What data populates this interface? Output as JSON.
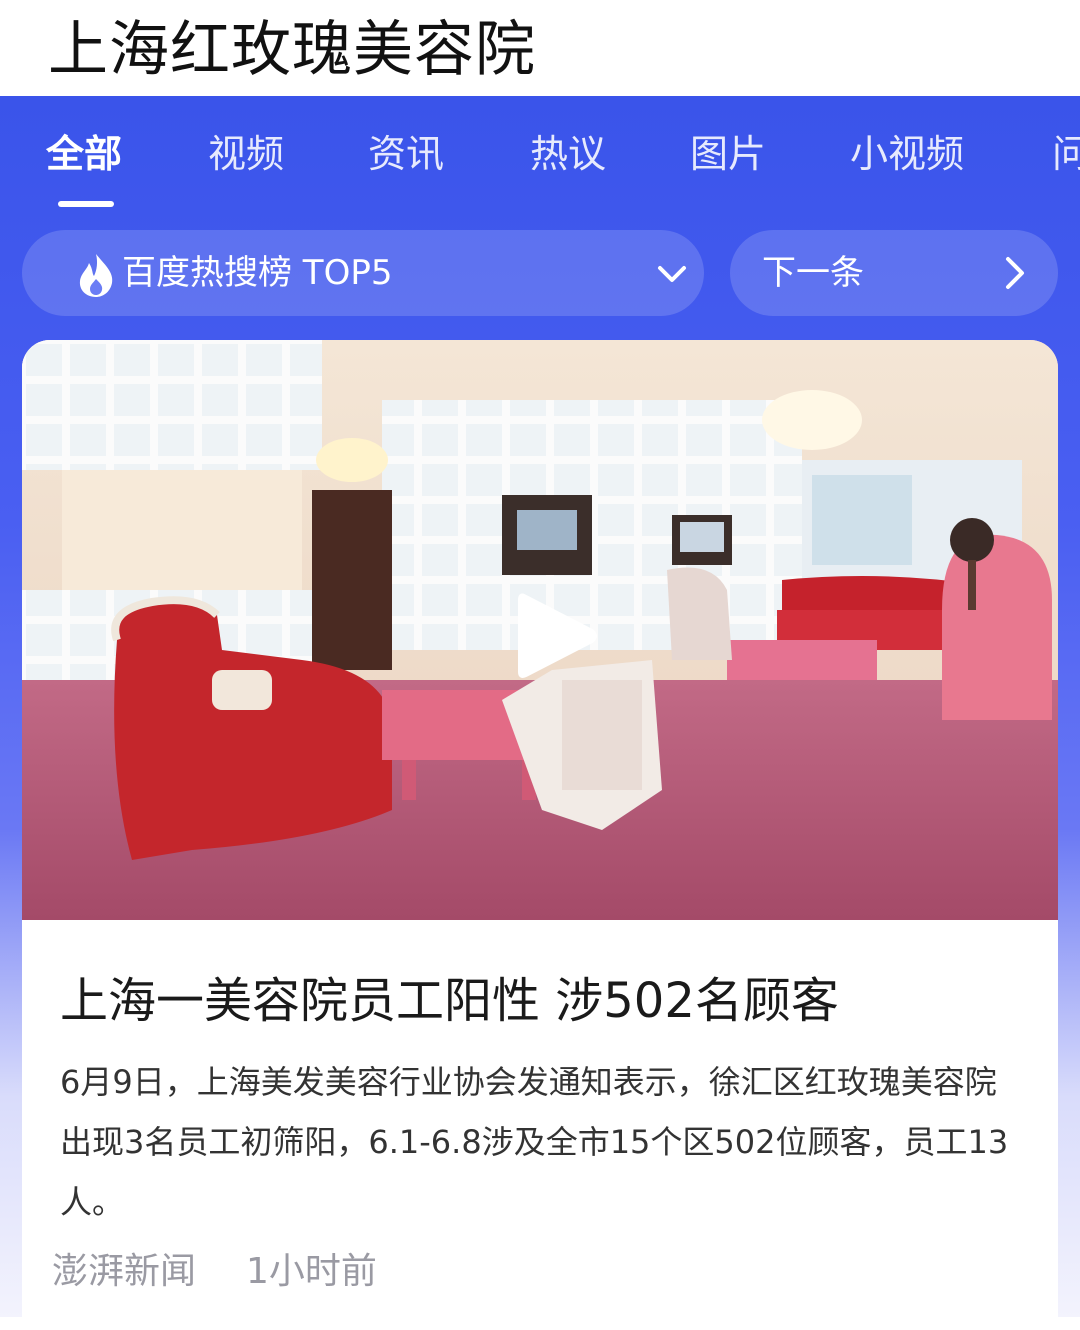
{
  "search": {
    "query": "上海红玫瑰美容院"
  },
  "tabs": [
    {
      "label": "全部",
      "active": true
    },
    {
      "label": "视频"
    },
    {
      "label": "资讯"
    },
    {
      "label": "热议"
    },
    {
      "label": "图片"
    },
    {
      "label": "小视频"
    },
    {
      "label": "问"
    }
  ],
  "hot_list": {
    "label": "百度热搜榜 TOP5",
    "icon": "flame-icon",
    "toggle_icon": "chevron-down-icon"
  },
  "next_item": {
    "label": "下一条",
    "icon": "chevron-right-icon"
  },
  "news": {
    "title": "上海一美容院员工阳性 涉502名顾客",
    "summary": "6月9日，上海美发美容行业协会发通知表示，徐汇区红玫瑰美容院出现3名员工初筛阳，6.1-6.8涉及全市15个区502位顾客，员工13人。",
    "source": "澎湃新闻",
    "time": "1小时前",
    "thumbnail_has_video": true
  },
  "colors": {
    "panel_top": "#3a54ea",
    "panel_bottom": "#f3f3fd",
    "accent_text": "#ffffff"
  }
}
